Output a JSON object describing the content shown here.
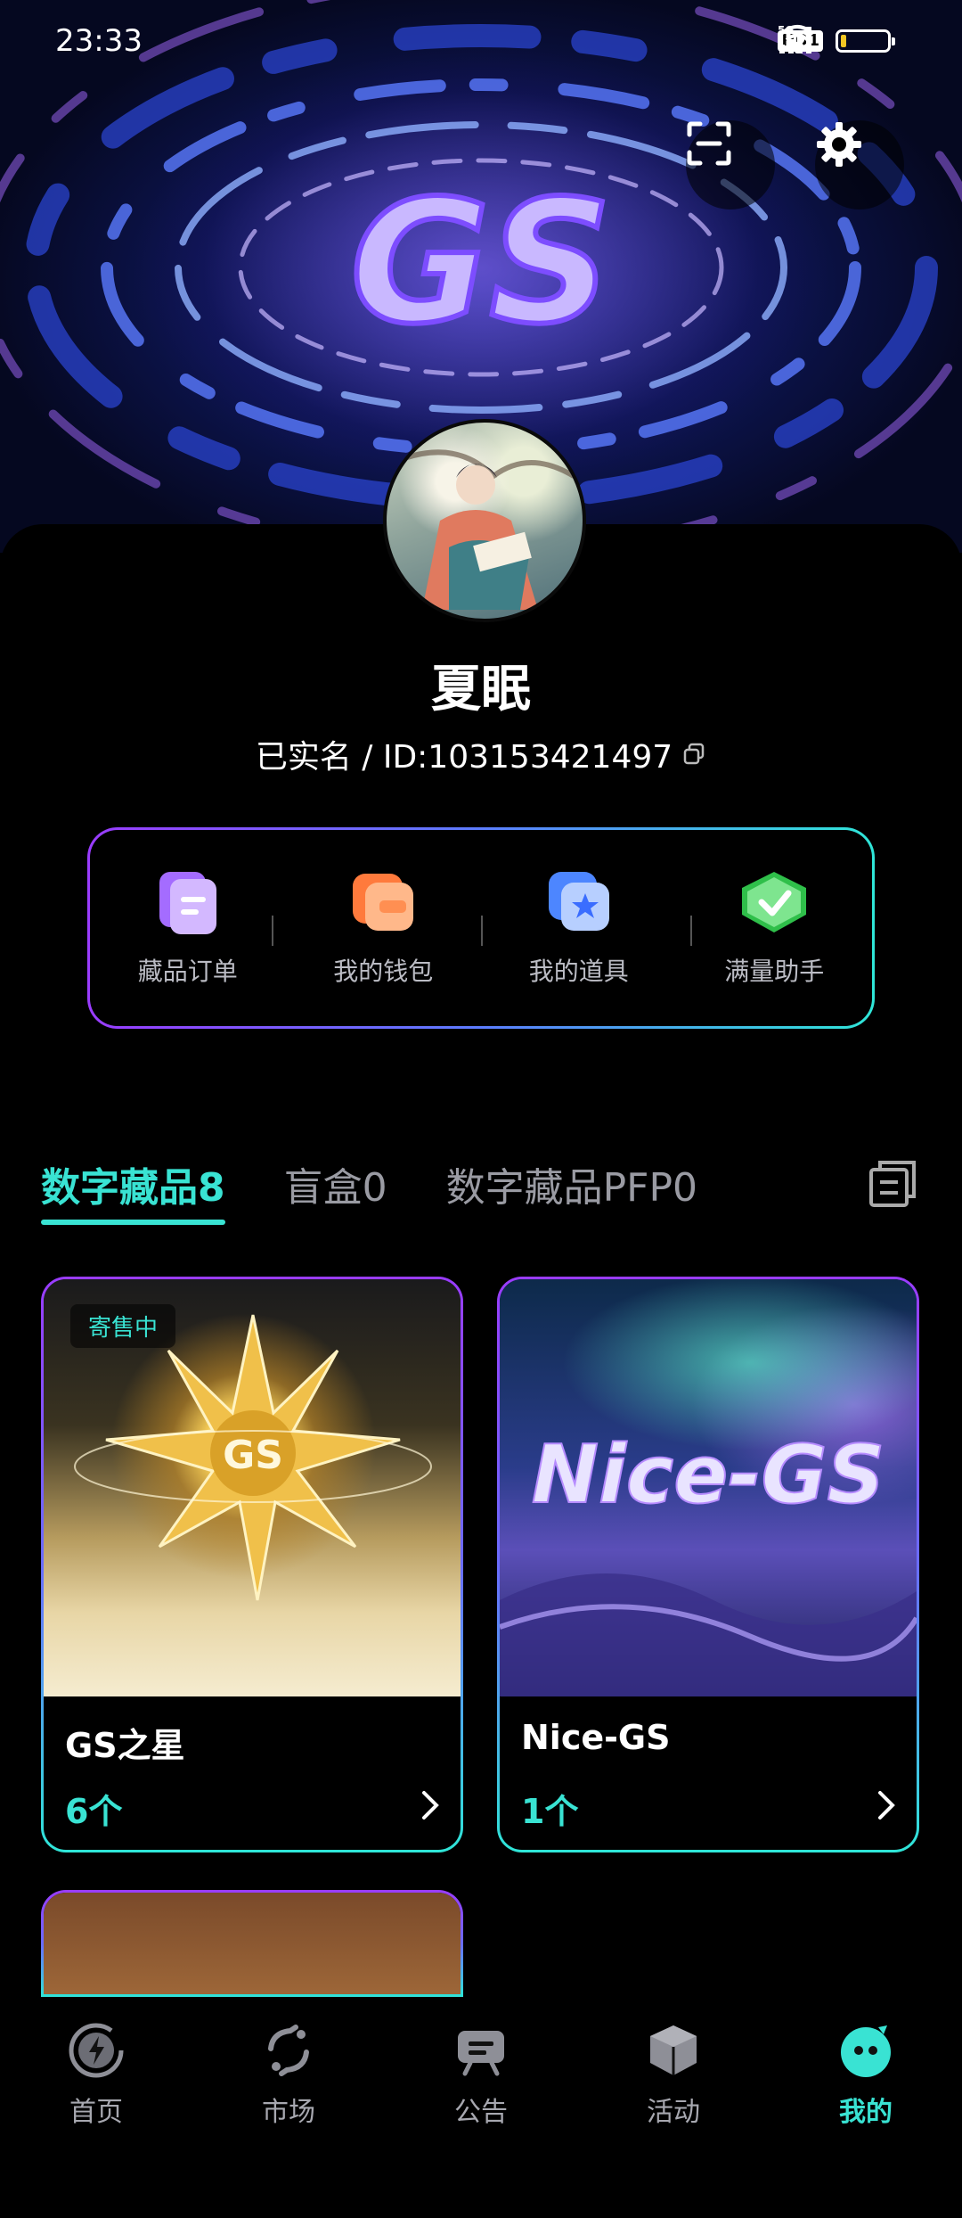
{
  "status_bar": {
    "time": "23:33",
    "hd": "HD1",
    "network": "5G"
  },
  "hero": {
    "logo_text": "GS"
  },
  "profile": {
    "nickname": "夏眠",
    "id_line": "已实名 / ID:103153421497"
  },
  "quick_actions": [
    {
      "label": "藏品订单",
      "icon": "document-icon",
      "color": "#b98bff"
    },
    {
      "label": "我的钱包",
      "icon": "wallet-icon",
      "color": "#ff9a5a"
    },
    {
      "label": "我的道具",
      "icon": "star-card-icon",
      "color": "#6fa2ff"
    },
    {
      "label": "满量助手",
      "icon": "check-badge-icon",
      "color": "#3fd56b"
    }
  ],
  "tabs": [
    {
      "label": "数字藏品8",
      "active": true
    },
    {
      "label": "盲盒0",
      "active": false
    },
    {
      "label": "数字藏品PFP0",
      "active": false
    }
  ],
  "cards": [
    {
      "title": "GS之星",
      "count": "6个",
      "badge": "寄售中",
      "image_text": "GS"
    },
    {
      "title": "Nice-GS",
      "count": "1个",
      "badge": "",
      "image_text": "Nice-GS"
    }
  ],
  "bottom_nav": [
    {
      "label": "首页",
      "icon": "lightning-icon",
      "active": false
    },
    {
      "label": "市场",
      "icon": "refresh-icon",
      "active": false
    },
    {
      "label": "公告",
      "icon": "notice-board-icon",
      "active": false
    },
    {
      "label": "活动",
      "icon": "cube-icon",
      "active": false
    },
    {
      "label": "我的",
      "icon": "profile-face-icon",
      "active": true
    }
  ],
  "colors": {
    "accent": "#39e3d3",
    "purple": "#9a3cff"
  }
}
